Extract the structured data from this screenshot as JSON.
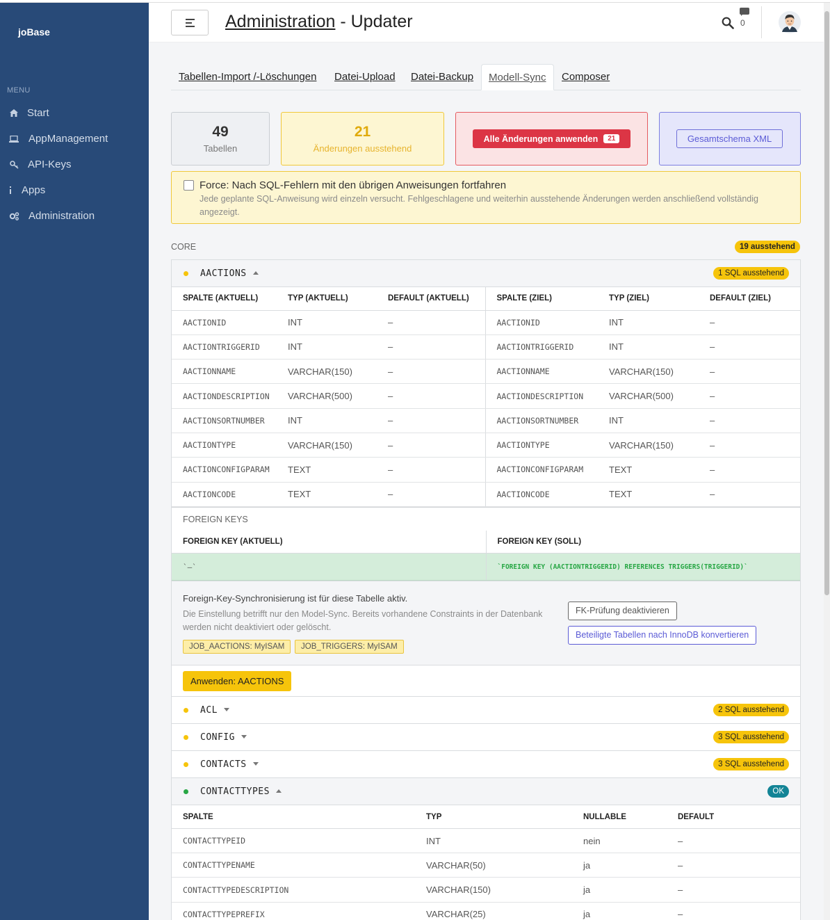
{
  "brand": "joBase",
  "menu": {
    "heading": "MENU",
    "items": [
      {
        "icon": "home-icon",
        "label": "Start"
      },
      {
        "icon": "laptop-icon",
        "label": "AppManagement"
      },
      {
        "icon": "key-icon",
        "label": "API-Keys"
      },
      {
        "icon": "info-icon",
        "label": "Apps"
      },
      {
        "icon": "gears-icon",
        "label": "Administration"
      }
    ]
  },
  "header": {
    "breadcrumb": "Administration",
    "separator": " - ",
    "title": "Updater",
    "chat_count": "0"
  },
  "tabs": [
    "Tabellen-Import /-Löschungen",
    "Datei-Upload",
    "Datei-Backup",
    "Modell-Sync",
    "Composer"
  ],
  "stats": {
    "tables_count": "49",
    "tables_label": "Tabellen",
    "pending_count": "21",
    "pending_label": "Änderungen ausstehend",
    "apply_all_label": "Alle Änderungen anwenden",
    "apply_all_badge": "21",
    "xml_label": "Gesamtschema XML"
  },
  "force": {
    "label": "Force: Nach SQL-Fehlern mit den übrigen Anweisungen fortfahren",
    "hint": "Jede geplante SQL-Anweisung wird einzeln versucht. Fehlgeschlagene und weiterhin ausstehende Änderungen werden anschließend vollständig angezeigt."
  },
  "core": {
    "label": "CORE",
    "pending": "19 ausstehend",
    "aactions": {
      "name": "AACTIONS",
      "pending": "1 SQL ausstehend",
      "columns": [
        "SPALTE (AKTUELL)",
        "TYP (AKTUELL)",
        "DEFAULT (AKTUELL)",
        "SPALTE (ZIEL)",
        "TYP (ZIEL)",
        "DEFAULT (ZIEL)"
      ],
      "rows": [
        [
          "AACTIONID",
          "INT",
          "–",
          "AACTIONID",
          "INT",
          "–"
        ],
        [
          "AACTIONTRIGGERID",
          "INT",
          "–",
          "AACTIONTRIGGERID",
          "INT",
          "–"
        ],
        [
          "AACTIONNAME",
          "VARCHAR(150)",
          "–",
          "AACTIONNAME",
          "VARCHAR(150)",
          "–"
        ],
        [
          "AACTIONDESCRIPTION",
          "VARCHAR(500)",
          "–",
          "AACTIONDESCRIPTION",
          "VARCHAR(500)",
          "–"
        ],
        [
          "AACTIONSORTNUMBER",
          "INT",
          "–",
          "AACTIONSORTNUMBER",
          "INT",
          "–"
        ],
        [
          "AACTIONTYPE",
          "VARCHAR(150)",
          "–",
          "AACTIONTYPE",
          "VARCHAR(150)",
          "–"
        ],
        [
          "AACTIONCONFIGPARAM",
          "TEXT",
          "–",
          "AACTIONCONFIGPARAM",
          "TEXT",
          "–"
        ],
        [
          "AACTIONCODE",
          "TEXT",
          "–",
          "AACTIONCODE",
          "TEXT",
          "–"
        ]
      ],
      "fk_label": "FOREIGN KEYS",
      "fk_columns": [
        "FOREIGN KEY (AKTUELL)",
        "FOREIGN KEY (SOLL)"
      ],
      "fk_current": "`–`",
      "fk_target": "`FOREIGN KEY (AACTIONTRIGGERID) REFERENCES TRIGGERS(TRIGGERID)`",
      "fk_sync_title": "Foreign-Key-Synchronisierung ist für diese Tabelle aktiv.",
      "fk_sync_hint": "Die Einstellung betrifft nur den Model-Sync. Bereits vorhandene Constraints in der Datenbank werden nicht deaktiviert oder gelöscht.",
      "engines": [
        "JOB_AACTIONS: MyISAM",
        "JOB_TRIGGERS: MyISAM"
      ],
      "btn_disable_fk": "FK-Prüfung deaktivieren",
      "btn_convert": "Beteiligte Tabellen nach InnoDB konvertieren",
      "btn_apply": "Anwenden: AACTIONS"
    },
    "collapsed": [
      {
        "name": "ACL",
        "pending": "2 SQL ausstehend"
      },
      {
        "name": "CONFIG",
        "pending": "3 SQL ausstehend"
      },
      {
        "name": "CONTACTS",
        "pending": "3 SQL ausstehend"
      }
    ],
    "contacttypes": {
      "name": "CONTACTTYPES",
      "status": "OK",
      "columns": [
        "SPALTE",
        "TYP",
        "NULLABLE",
        "DEFAULT"
      ],
      "rows": [
        [
          "CONTACTTYPEID",
          "INT",
          "nein",
          "–"
        ],
        [
          "CONTACTTYPENAME",
          "VARCHAR(50)",
          "ja",
          "–"
        ],
        [
          "CONTACTTYPEDESCRIPTION",
          "VARCHAR(150)",
          "ja",
          "–"
        ],
        [
          "CONTACTTYPEPREFIX",
          "VARCHAR(25)",
          "ja",
          "–"
        ]
      ]
    }
  }
}
